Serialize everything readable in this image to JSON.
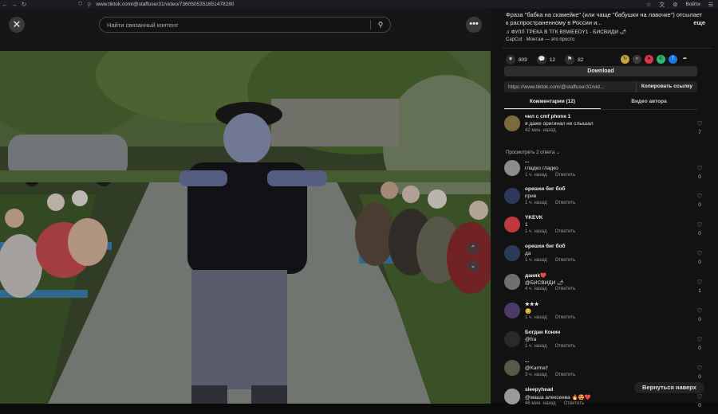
{
  "browser": {
    "url": "www.tiktok.com/@staffuser31/video/7360505351851478280",
    "signin": "Войти"
  },
  "header": {
    "search_placeholder": "Найти связанный контент"
  },
  "video": {
    "description": "Фраза \"бабка на скамейке\" (или чаще \"бабушки на лавочке\") отсылает к распространенному в России и...",
    "more_label": "еще",
    "music": "♫  ФУЛЛ ТРЕКА В ТГК BSWEEDY1 - БИСВИДИ 🌶",
    "capcut": "CapCut · Монтаж — это просто"
  },
  "stats": {
    "likes": "809",
    "comments": "12",
    "saves": "82"
  },
  "share_colors": [
    "#c8a53a",
    "#3a3a3a",
    "#e0324b",
    "#25c26e",
    "#1877f2"
  ],
  "actions": {
    "download_label": "Download",
    "link_url": "https://www.tiktok.com/@staffuser31/vid...",
    "copy_label": "Копировать ссылку"
  },
  "tabs": [
    {
      "label": "Комментарии (12)"
    },
    {
      "label": "Видео автора"
    }
  ],
  "view_replies": "Просмотреть 2 ответа ⌄",
  "comments": [
    {
      "name": "чил с cmf phone 1",
      "text": "я даже оригинал не слышал",
      "time": "42 мин. назад",
      "reply": "",
      "likes": "7",
      "avatar": "#7a6a3c"
    },
    {
      "name": "...",
      "text": "гладко гладко",
      "time": "1 ч. назад",
      "reply": "Ответить",
      "likes": "0",
      "avatar": "#8c8c8c"
    },
    {
      "name": "орешки биг боб",
      "text": "прив",
      "time": "1 ч. назад",
      "reply": "Ответить",
      "likes": "0",
      "avatar": "#2b3a5a"
    },
    {
      "name": "YKEVK",
      "text": "1",
      "time": "1 ч. назад",
      "reply": "Ответить",
      "likes": "0",
      "avatar": "#c0393b"
    },
    {
      "name": "орешки биг боб",
      "text": "да",
      "time": "1 ч. назад",
      "reply": "Ответить",
      "likes": "0",
      "avatar": "#2b3a5a"
    },
    {
      "name": "даняk❤️",
      "text": "@БИСВИДИ 🌶",
      "time": "4 ч. назад",
      "reply": "Ответить",
      "likes": "1",
      "avatar": "#6f6f6f"
    },
    {
      "name": "★★★",
      "text": "😊",
      "time": "1 ч. назад",
      "reply": "Ответить",
      "likes": "0",
      "avatar": "#4a3a6a"
    },
    {
      "name": "Богдан Конин",
      "text": "@fra",
      "time": "1 ч. назад",
      "reply": "Ответить",
      "likes": "0",
      "avatar": "#2a2a2a"
    },
    {
      "name": "...",
      "text": "@Karma†",
      "time": "3 ч. назад",
      "reply": "Ответить",
      "likes": "0",
      "avatar": "#5a5a4a"
    },
    {
      "name": "sleepyhead",
      "text": "@маша алексеева 🔥😍❤️",
      "time": "46 мин. назад",
      "reply": "Ответить",
      "likes": "0",
      "avatar": "#9a9a9a"
    }
  ],
  "back_to_top": "Вернуться наверх"
}
